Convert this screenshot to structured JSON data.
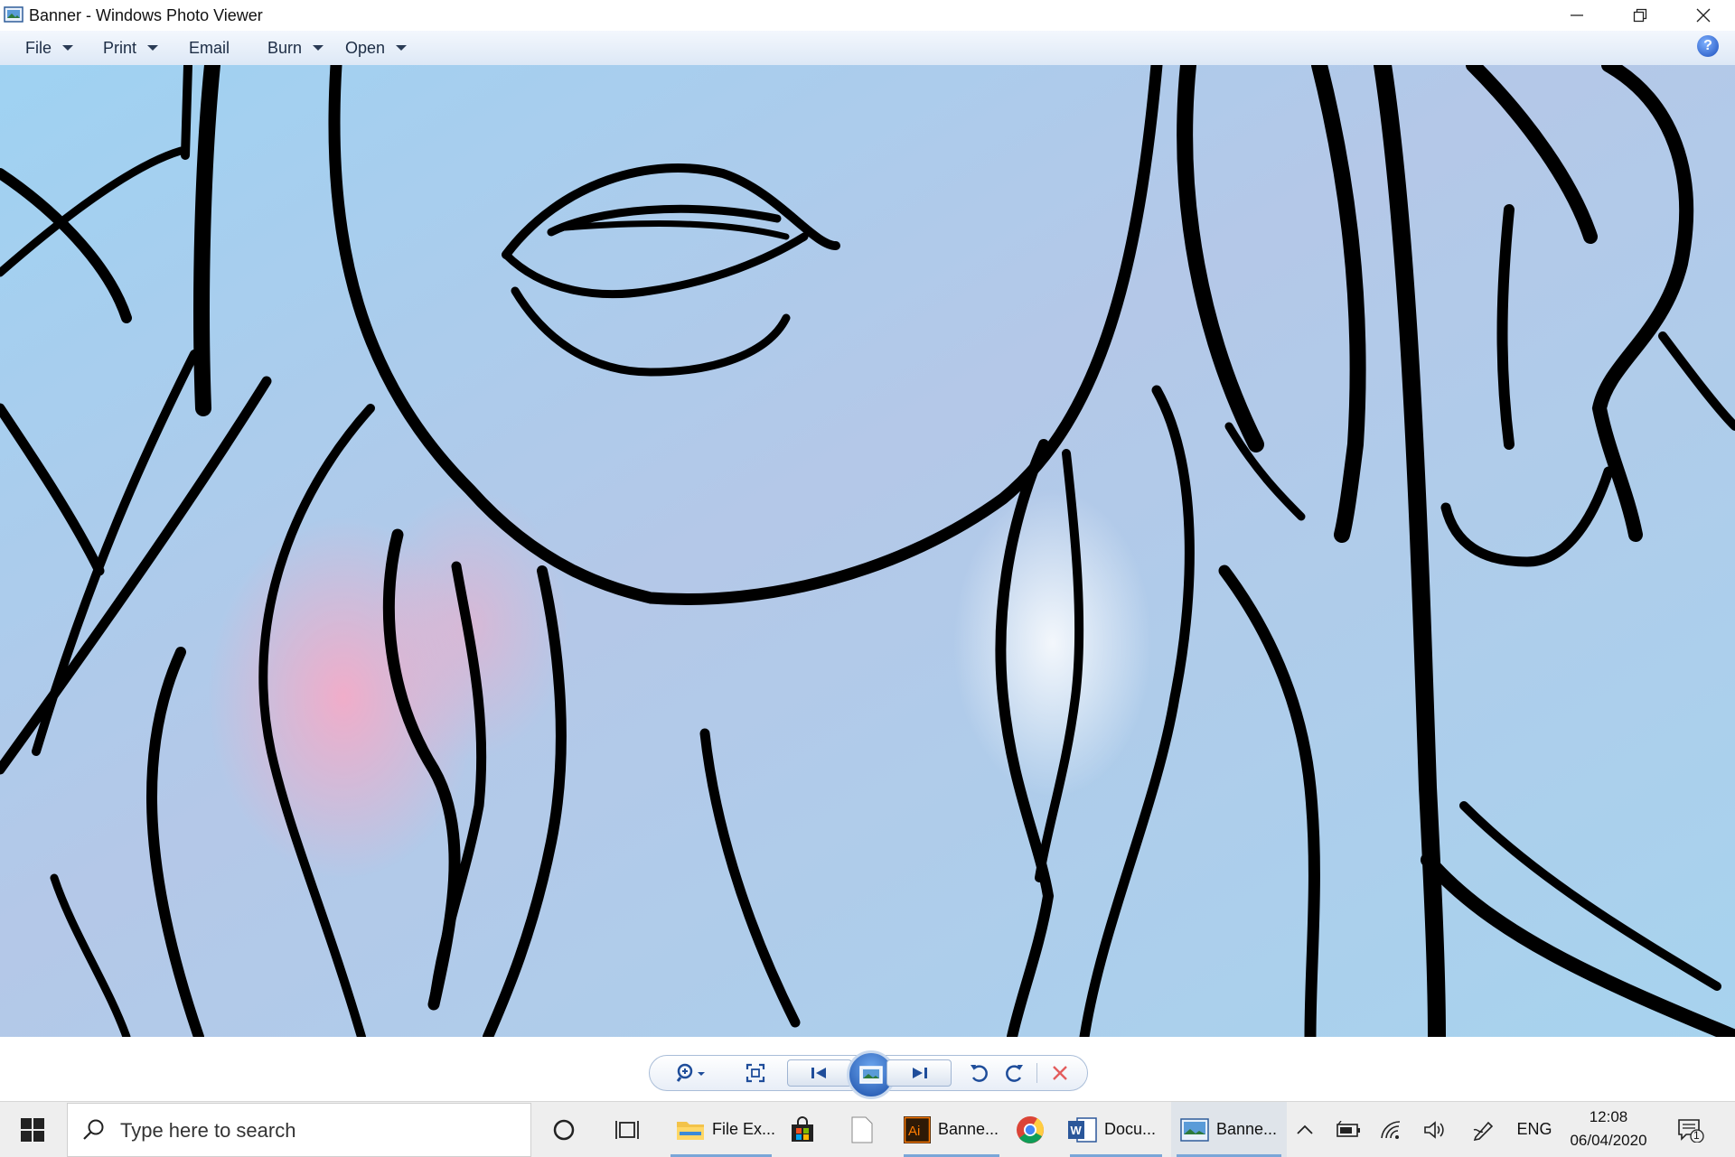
{
  "window": {
    "title": "Banner - Windows Photo Viewer"
  },
  "menu": {
    "items": [
      {
        "label": "File",
        "dropdown": true
      },
      {
        "label": "Print",
        "dropdown": true
      },
      {
        "label": "Email",
        "dropdown": false
      },
      {
        "label": "Burn",
        "dropdown": true
      },
      {
        "label": "Open",
        "dropdown": true
      }
    ],
    "help": "?"
  },
  "image": {
    "content": "zoomed line-art drawing of a face",
    "background_colors": [
      "#a9d6f2",
      "#b7c6e6",
      "#f2b4cc"
    ]
  },
  "controls": {
    "buttons": [
      "zoom-icon",
      "fit-to-window-icon",
      "previous-icon",
      "slideshow-icon",
      "next-icon",
      "rotate-counterclockwise-icon",
      "rotate-clockwise-icon",
      "delete-icon"
    ]
  },
  "taskbar": {
    "search_placeholder": "Type here to search",
    "apps": [
      {
        "label": "File Ex...",
        "icon": "folder-icon"
      },
      {
        "label": "",
        "icon": "store-icon"
      },
      {
        "label": "",
        "icon": "document-icon"
      },
      {
        "label": "Banne...",
        "icon": "illustrator-icon"
      },
      {
        "label": "",
        "icon": "chrome-icon"
      },
      {
        "label": "Docu...",
        "icon": "word-icon"
      },
      {
        "label": "Banne...",
        "icon": "photo-viewer-icon"
      }
    ],
    "language": "ENG",
    "time": "12:08",
    "date": "06/04/2020",
    "notification_count": "1",
    "colors": {
      "accent": "#0078d7",
      "illustrator": "#ff7c00",
      "word": "#2b579a"
    }
  }
}
